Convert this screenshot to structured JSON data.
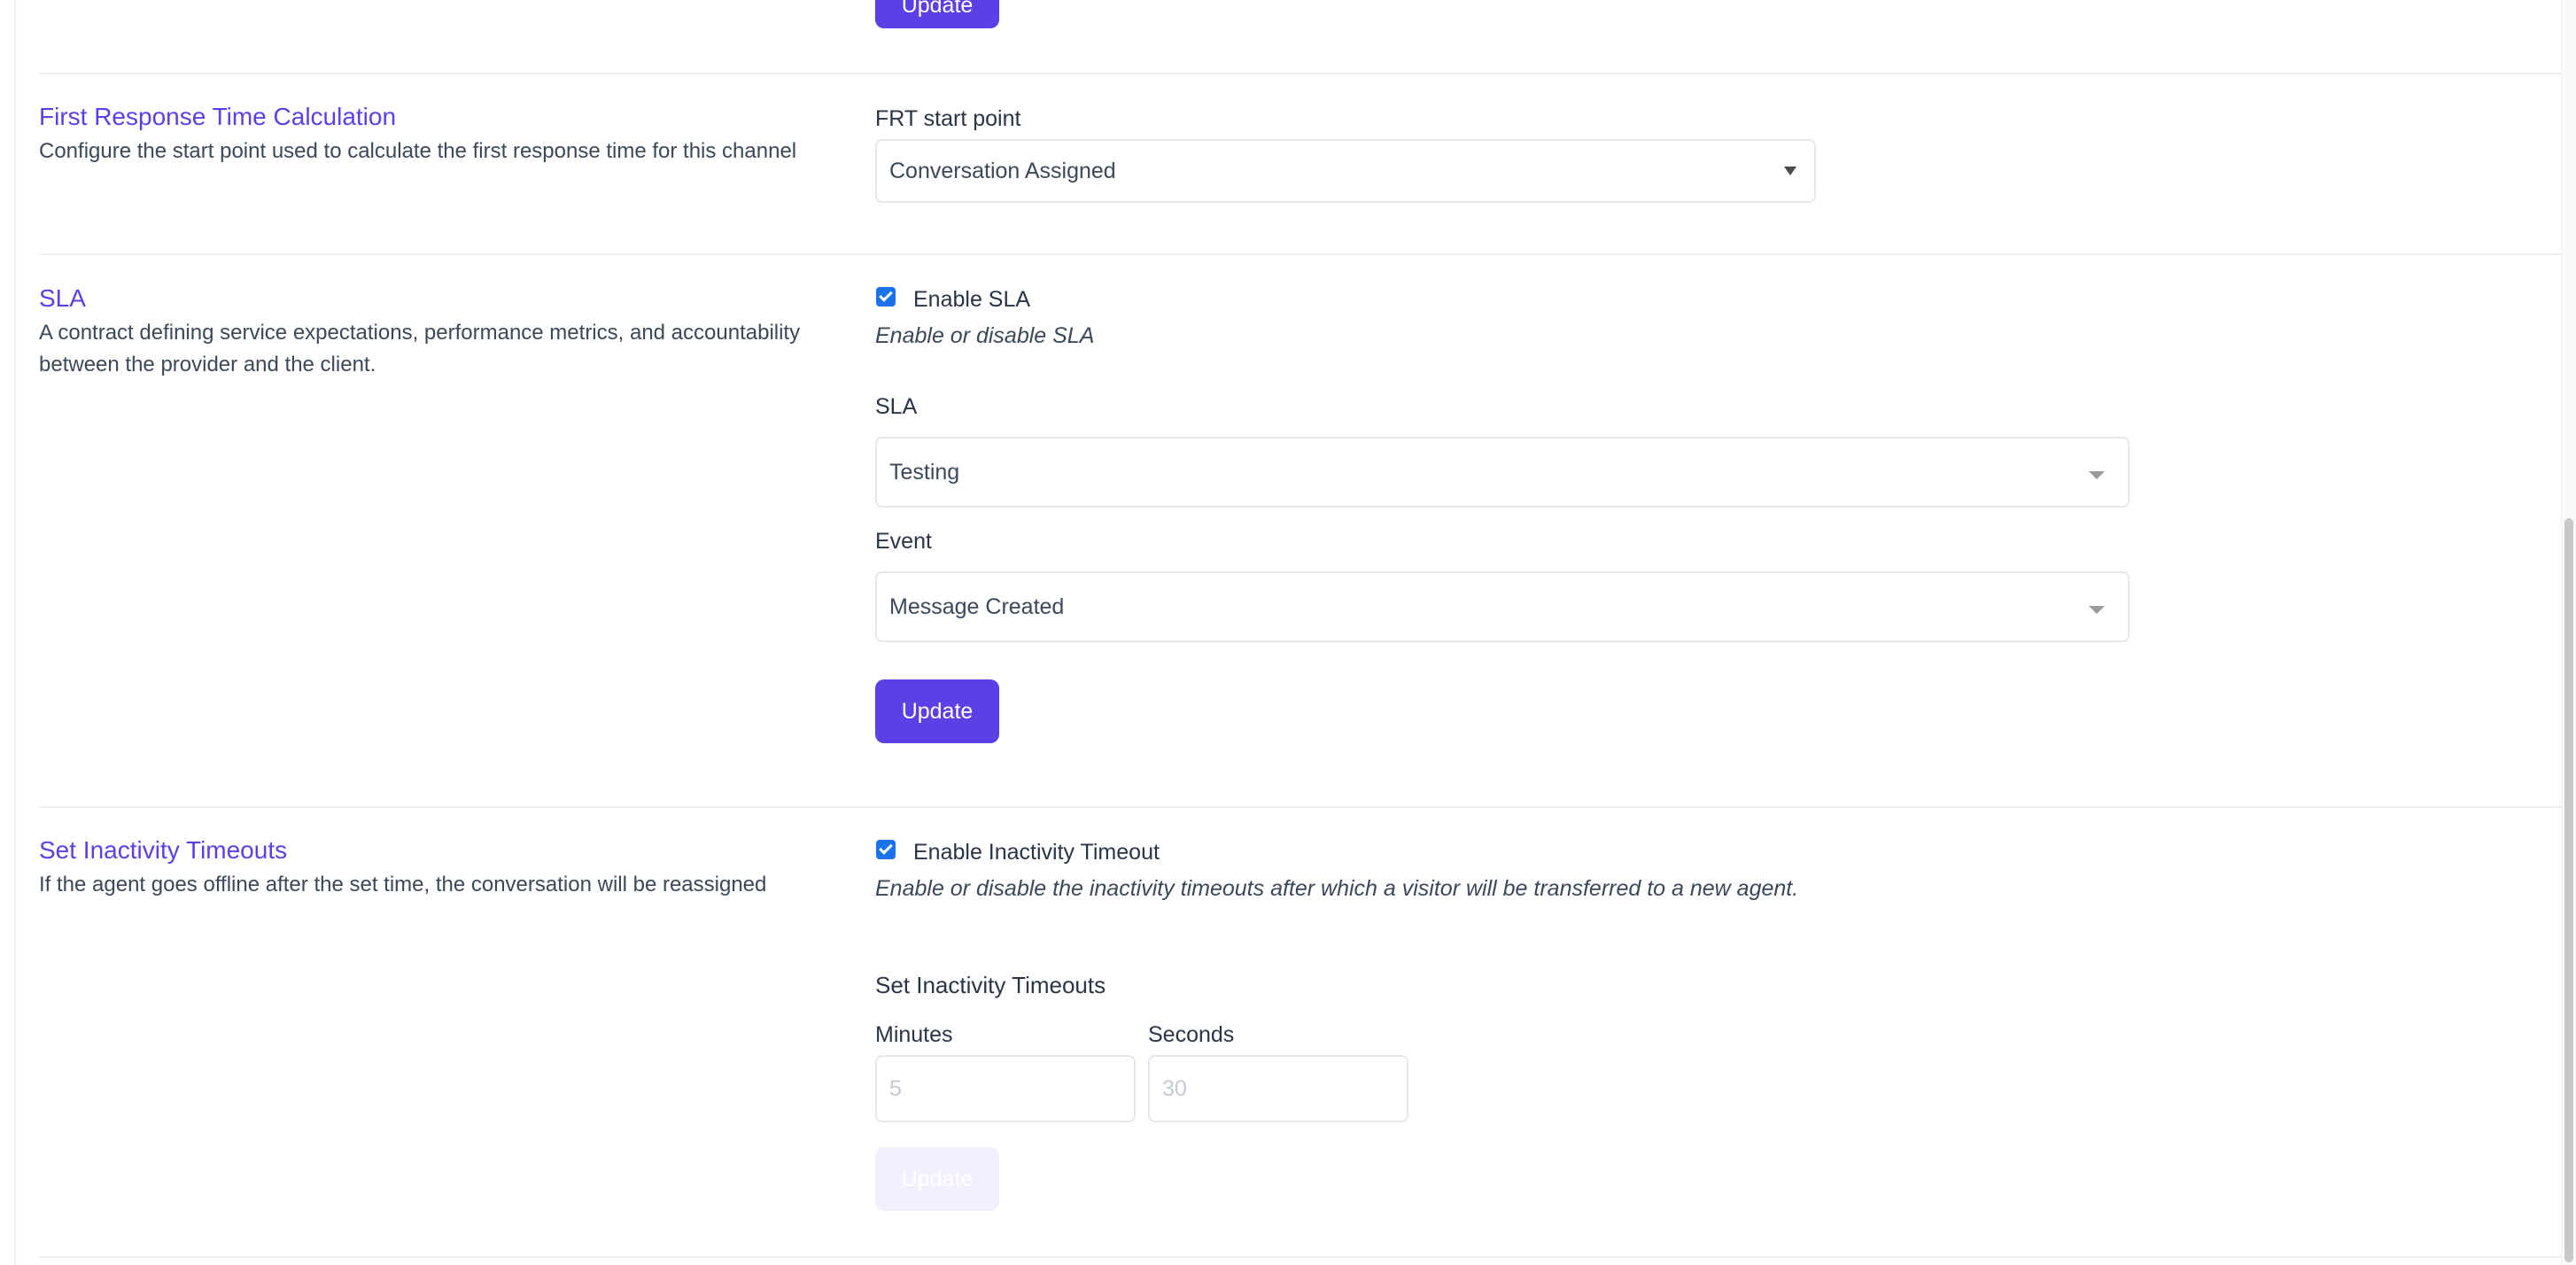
{
  "top": {
    "update_label": "Update"
  },
  "frt": {
    "title": "First Response Time Calculation",
    "description": "Configure the start point used to calculate the first response time for this channel",
    "field_label": "FRT start point",
    "selected": "Conversation Assigned"
  },
  "sla": {
    "title": "SLA",
    "description": "A contract defining service expectations, performance metrics, and accountability between the provider and the client.",
    "enable_label": "Enable SLA",
    "enable_help": "Enable or disable SLA",
    "sla_label": "SLA",
    "sla_selected": "Testing",
    "event_label": "Event",
    "event_selected": "Message Created",
    "update_label": "Update"
  },
  "inactivity": {
    "title": "Set Inactivity Timeouts",
    "description": "If the agent goes offline after the set time, the conversation will be reassigned",
    "enable_label": "Enable Inactivity Timeout",
    "enable_help": "Enable or disable the inactivity timeouts after which a visitor will be transferred to a new agent.",
    "subheading": "Set Inactivity Timeouts",
    "minutes_label": "Minutes",
    "minutes_placeholder": "5",
    "seconds_label": "Seconds",
    "seconds_placeholder": "30",
    "update_label": "Update"
  },
  "colors": {
    "accent": "#5d3fe6",
    "checkbox": "#1a73e8",
    "disabled_button": "#f2efff"
  },
  "icons": {
    "select_arrow": "chevron-down-icon",
    "checkbox_checked": "check-icon"
  }
}
